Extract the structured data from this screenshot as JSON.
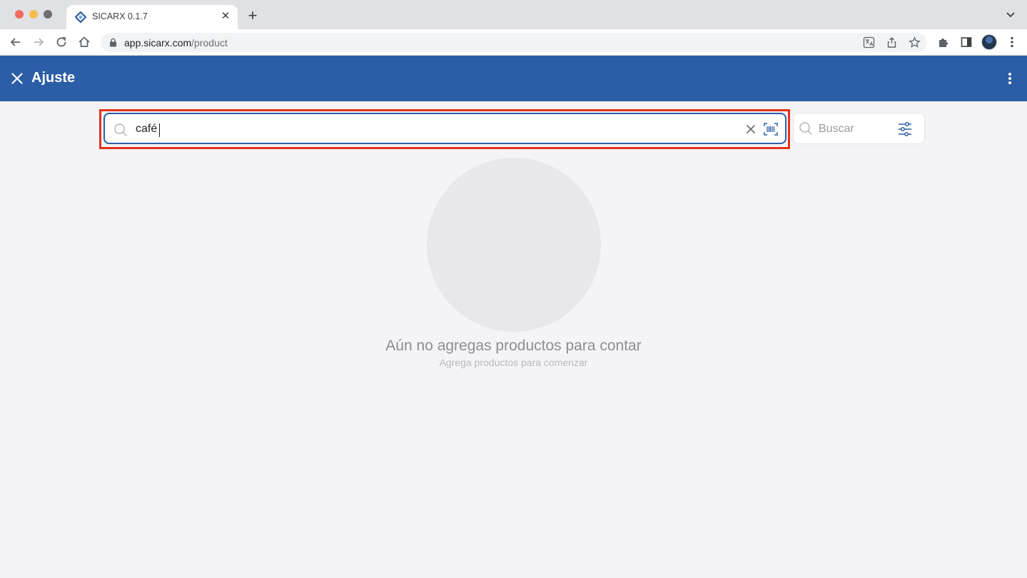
{
  "browser": {
    "tab_title": "SICARX 0.1.7",
    "url_host": "app.sicarx.com",
    "url_path": "/product",
    "icons": [
      "sicarx-logo-icon",
      "close-icon",
      "plus-icon",
      "chevron-down-icon",
      "back-arrow-icon",
      "forward-arrow-icon",
      "reload-icon",
      "home-icon",
      "lock-icon",
      "translate-icon",
      "share-icon",
      "star-icon",
      "puzzle-icon",
      "side-panel-icon",
      "profile-avatar",
      "kebab-menu-icon"
    ]
  },
  "header": {
    "title": "Ajuste",
    "background": "#2b5ea7"
  },
  "search": {
    "value": "café",
    "highlight_color": "#e3321f",
    "icons": [
      "search-icon",
      "clear-icon",
      "barcode-scan-icon"
    ]
  },
  "filter": {
    "placeholder": "Buscar",
    "icons": [
      "search-icon",
      "sliders-icon"
    ]
  },
  "empty_state": {
    "title": "Aún no agregas productos para contar",
    "subtitle": "Agrega productos para comenzar"
  }
}
